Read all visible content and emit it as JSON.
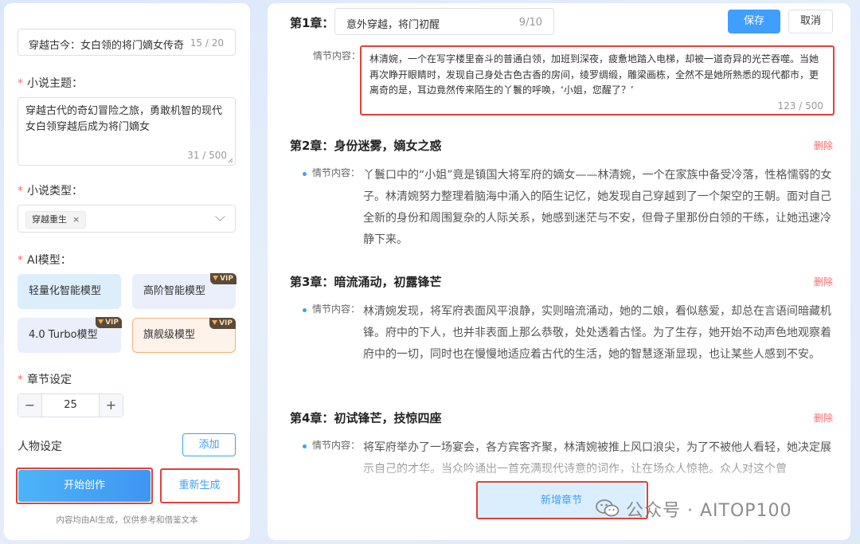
{
  "left": {
    "title_input": {
      "value": "穿越古今：女白领的将门嫡女传奇",
      "counter": "15 / 20"
    },
    "theme": {
      "label": "小说主题：",
      "value": "穿越古代的奇幻冒险之旅，勇敢机智的现代女白领穿越后成为将门嫡女",
      "counter": "31 / 500"
    },
    "genre": {
      "label": "小说类型：",
      "tag": "穿越重生",
      "tag_close": "×"
    },
    "ai_model": {
      "label": "AI模型：",
      "options": [
        {
          "label": "轻量化智能模型",
          "vip": false
        },
        {
          "label": "高阶智能模型",
          "vip": true
        },
        {
          "label": "4.0 Turbo模型",
          "vip": true
        },
        {
          "label": "旗舰级模型",
          "vip": true,
          "selected": true
        }
      ],
      "vip_text": "VIP"
    },
    "chapters": {
      "label": "章节设定",
      "value": "25",
      "minus": "−",
      "plus": "+"
    },
    "characters": {
      "label": "人物设定",
      "add_label": "添加"
    },
    "start_label": "开始创作",
    "regen_label": "重新生成",
    "footnote": "内容均由AI生成，仅供参考和借鉴文本"
  },
  "right": {
    "chapter1": {
      "label": "第1章：",
      "title": "意外穿越，将门初醒",
      "title_counter": "9/10",
      "save_label": "保存",
      "cancel_label": "取消",
      "plot_label": "情节内容：",
      "plot": "林清婉，一个在写字楼里奋斗的普通白领，加班到深夜，疲惫地踏入电梯，却被一道奇异的光芒吞噬。当她再次睁开眼睛时，发现自己身处古色古香的房间，绫罗绸缎，雕梁画栋，全然不是她所熟悉的现代都市，更离奇的是，耳边竟然传来陌生的丫鬟的呼唤，‘小姐，您醒了？’",
      "plot_counter": "123 / 500"
    },
    "delete_label": "删除",
    "plot_label": "情节内容：",
    "chapters": [
      {
        "label": "第2章：",
        "title": "身份迷雾，嫡女之惑",
        "plot": "丫鬟口中的“小姐”竟是镇国大将军府的嫡女——林清婉，一个在家族中备受冷落，性格懦弱的女子。林清婉努力整理着脑海中涌入的陌生记忆，她发现自己穿越到了一个架空的王朝。面对自己全新的身份和周围复杂的人际关系，她感到迷茫与不安，但骨子里那份白领的干练，让她迅速冷静下来。"
      },
      {
        "label": "第3章：",
        "title": "暗流涌动，初露锋芒",
        "plot": "林清婉发现，将军府表面风平浪静，实则暗流涌动，她的二娘，看似慈爱，却总在言语间暗藏机锋。府中的下人，也并非表面上那么恭敬，处处透着古怪。为了生存，她开始不动声色地观察着府中的一切，同时也在慢慢地适应着古代的生活，她的智慧逐渐显现，也让某些人感到不安。"
      },
      {
        "label": "第4章：",
        "title": "初试锋芒，技惊四座",
        "plot": "将军府举办了一场宴会，各方宾客齐聚，林清婉被推上风口浪尖，为了不被他人看轻，她决定展示自己的才华。当众吟诵出一首充满现代诗意的词作，让在场众人惊艳。众人对这个曾"
      }
    ],
    "new_chapter_label": "新增章节"
  },
  "watermark": "公众号 · AITOP100",
  "colors": {
    "accent": "#409eff",
    "danger": "#f56c6c",
    "highlight_frame": "#e0413a"
  }
}
